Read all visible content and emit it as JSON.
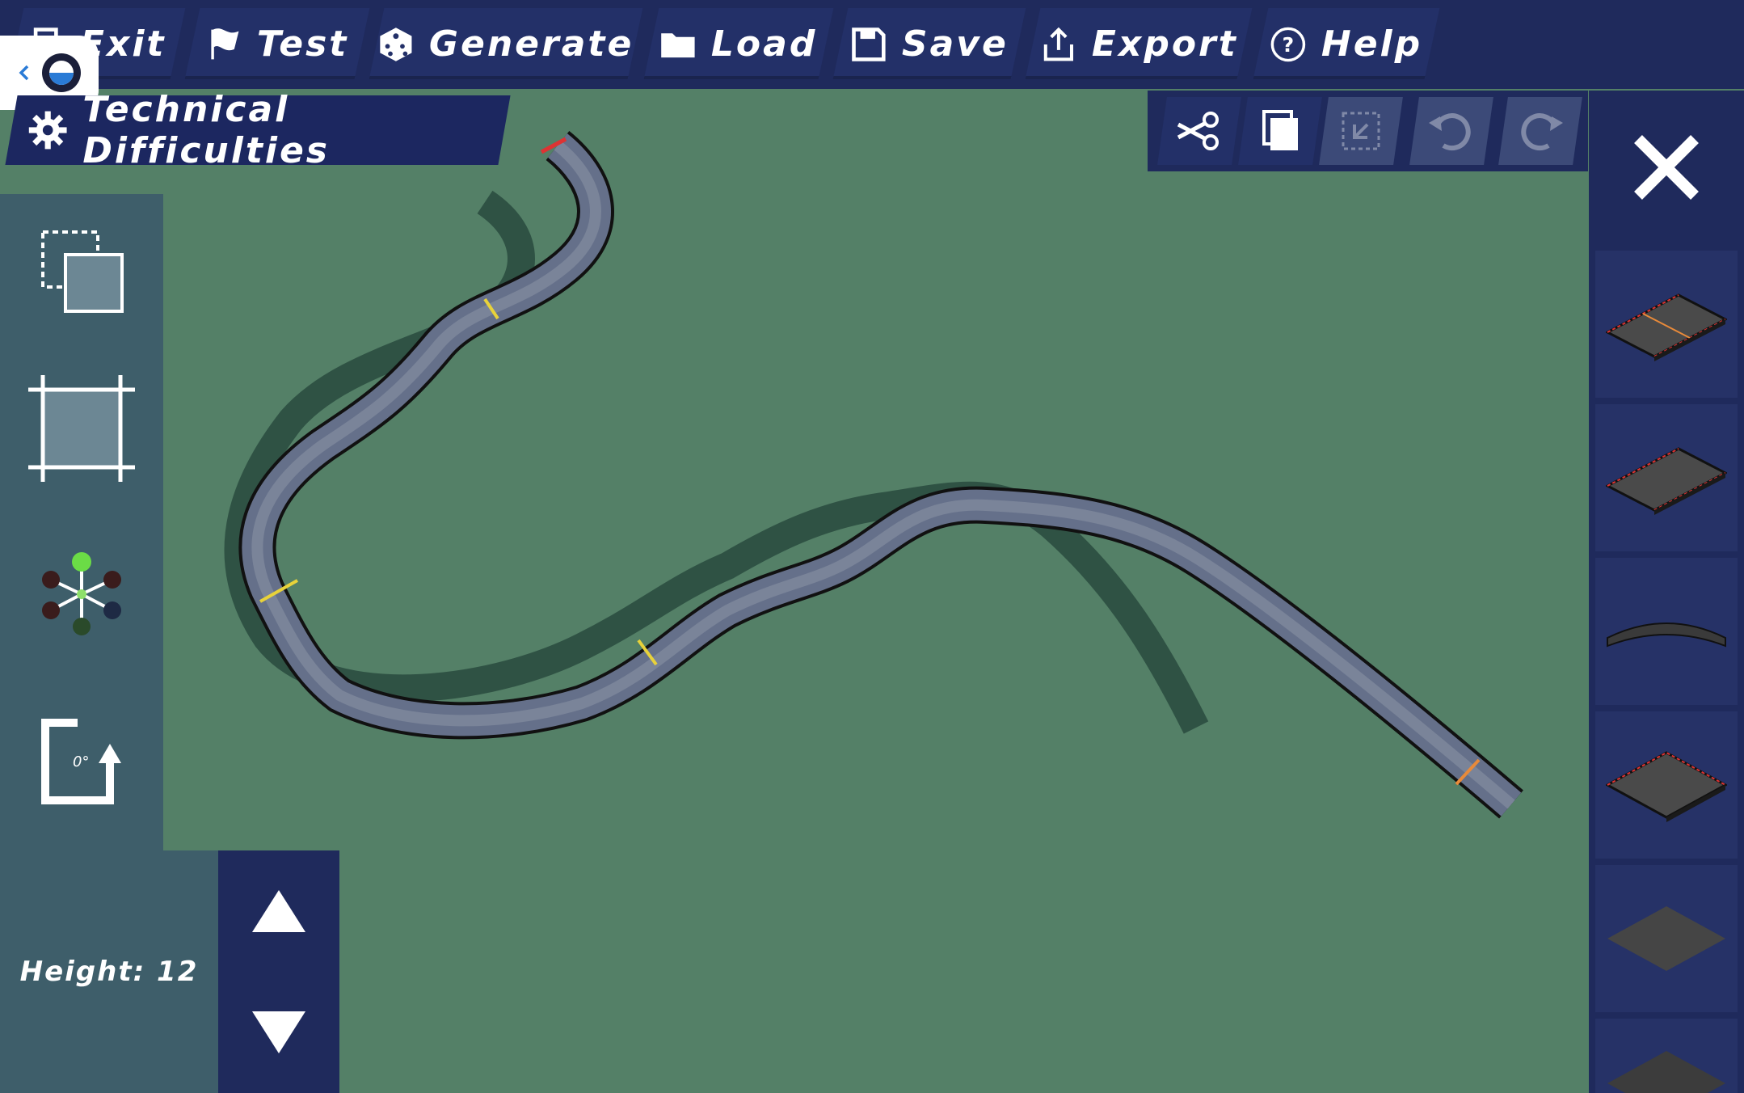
{
  "menu": {
    "exit": "Exit",
    "test": "Test",
    "generate": "Generate",
    "load": "Load",
    "save": "Save",
    "export": "Export",
    "help": "Help"
  },
  "track": {
    "title": "Technical Difficulties"
  },
  "height": {
    "label": "Height: 12"
  },
  "rotation": {
    "label": "0°"
  },
  "colors": {
    "grass": "#548067",
    "panel": "#1f2a5c",
    "button": "#233068",
    "toolpanel": "#3e5e6a",
    "road": "#65708a",
    "shadow": "#2f5244"
  },
  "icons": {
    "cut": "scissors-icon",
    "copy": "copy-icon",
    "paste": "paste-icon",
    "undo": "undo-icon",
    "redo": "redo-icon",
    "close": "close-icon"
  }
}
